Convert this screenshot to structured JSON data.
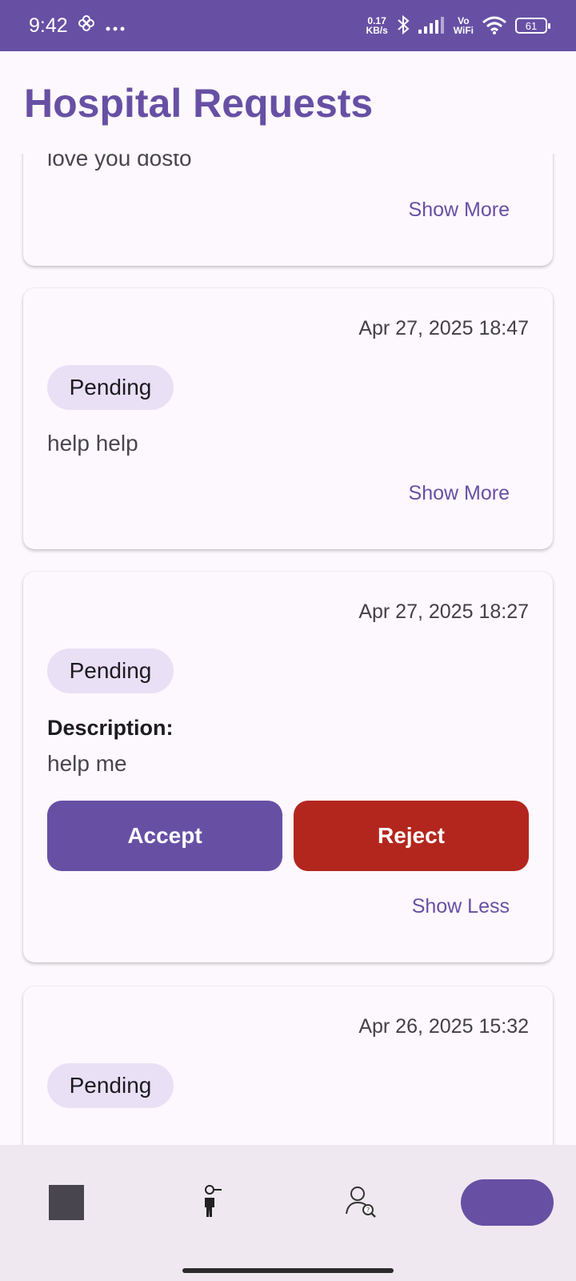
{
  "status_bar": {
    "time": "9:42",
    "net_speed_value": "0.17",
    "net_speed_unit": "KB/s",
    "vowifi_top": "Vo",
    "vowifi_bottom": "WiFi",
    "battery": "61",
    "icons": [
      "fan-icon",
      "more-dots-icon",
      "bluetooth-icon",
      "signal-icon",
      "wifi-icon",
      "battery-icon"
    ]
  },
  "header": {
    "title": "Hospital Requests"
  },
  "requests": [
    {
      "message": "love you dosto",
      "toggle_label": "Show More"
    },
    {
      "date": "Apr 27, 2025 18:47",
      "status": "Pending",
      "message": "help help",
      "toggle_label": "Show More"
    },
    {
      "date": "Apr 27, 2025 18:27",
      "status": "Pending",
      "description_label": "Description:",
      "message": "help me",
      "accept_label": "Accept",
      "reject_label": "Reject",
      "toggle_label": "Show Less"
    },
    {
      "date": "Apr 26, 2025 15:32",
      "status": "Pending"
    }
  ],
  "bottom_nav": {
    "items": [
      "square-icon",
      "person-search-icon",
      "user-query-icon",
      "pill-indicator"
    ]
  },
  "colors": {
    "primary": "#6750a4",
    "reject": "#b3261e",
    "chip": "#e9e0f6",
    "background": "#fdf8fd",
    "nav_background": "#efe8f1"
  }
}
